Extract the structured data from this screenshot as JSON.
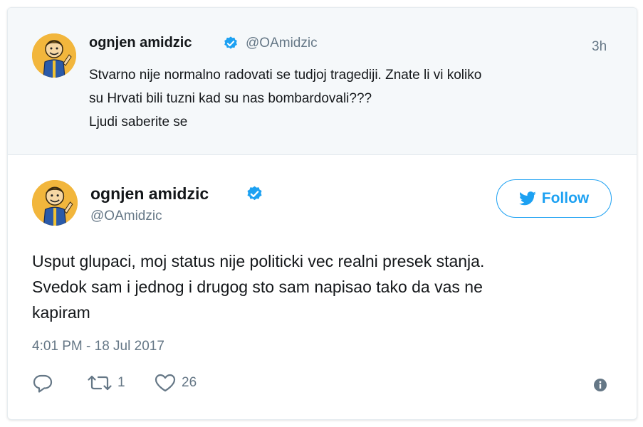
{
  "quoted_tweet": {
    "author_name": "ognjen amidzic",
    "handle": "@OAmidzic",
    "time": "3h",
    "text_lines": [
      "Stvarno nije normalno radovati se tudjoj tragediji. Znate li vi koliko",
      "su Hrvati bili tuzni kad su nas bombardovali???",
      "Ljudi saberite se"
    ]
  },
  "main_tweet": {
    "author_name": "ognjen amidzic",
    "handle": "@OAmidzic",
    "follow_label": "Follow",
    "text_lines": [
      "Usput glupaci, moj status nije politicki vec realni presek stanja.",
      "Svedok sam i jednog i drugog sto sam napisao tako da vas ne",
      "kapiram"
    ],
    "timestamp": "4:01 PM - 18 Jul 2017",
    "actions": {
      "retweet_count": "1",
      "like_count": "26"
    }
  },
  "colors": {
    "accent": "#1da1f2",
    "muted": "#657786",
    "quoted_bg": "#f5f8fa"
  },
  "icons": [
    "verified-badge-icon",
    "twitter-bird-icon",
    "reply-icon",
    "retweet-icon",
    "heart-icon",
    "info-icon"
  ]
}
